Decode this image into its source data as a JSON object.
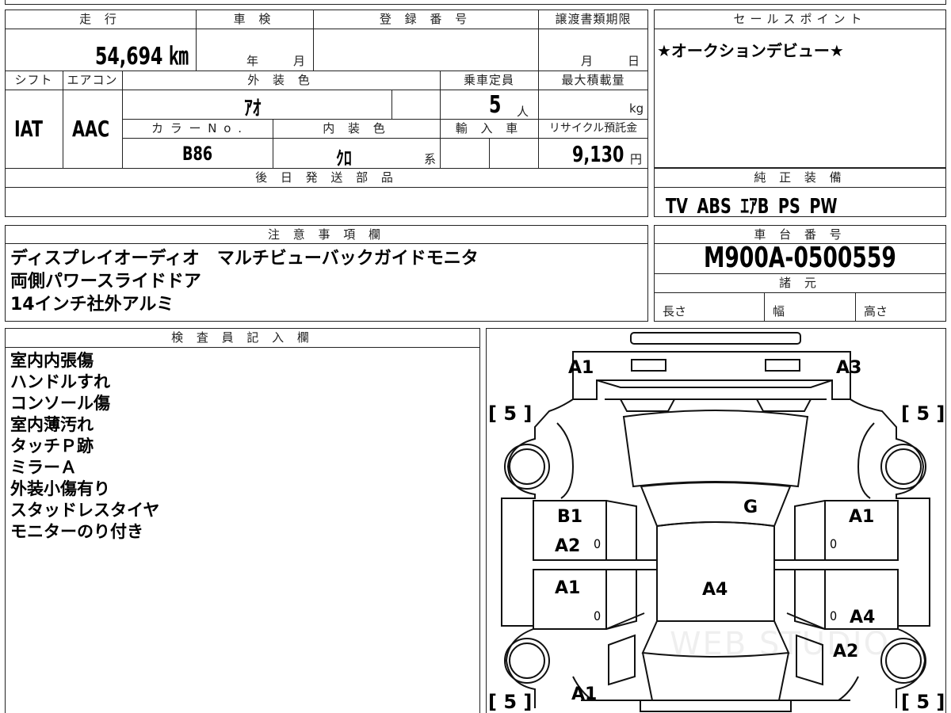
{
  "vehicle": {
    "mileage_label": "走 行",
    "mileage": "54,694 ㎞",
    "inspection_label": "車 検",
    "inspection_year_unit": "年",
    "inspection_month_unit": "月",
    "registration_label": "登 録 番 号",
    "transfer_deadline_label": "譲渡書類期限",
    "transfer_month_unit": "月",
    "transfer_day_unit": "日",
    "shift_label": "シフト",
    "shift": "IAT",
    "aircon_label": "エアコン",
    "aircon": "AAC",
    "exterior_color_label": "外 装 色",
    "exterior_color": "ｱｵ",
    "capacity_label": "乗車定員",
    "capacity": "5",
    "capacity_unit": "人",
    "max_load_label": "最大積載量",
    "max_load_unit": "kg",
    "color_no_label": "カ ラ ー N o .",
    "color_no": "B86",
    "interior_color_label": "内 装 色",
    "interior_color": "ｸﾛ",
    "interior_color_suffix": "系",
    "import_label": "輸 入 車",
    "recycle_label": "リサイクル預託金",
    "recycle_fee": "9,130",
    "recycle_unit": "円",
    "later_parts_label": "後 日 発 送 部 品"
  },
  "sales_point": {
    "label": "セールスポイント",
    "text": "★オークションデビュー★"
  },
  "standard_equipment": {
    "label": "純 正 装 備",
    "text": "TV ABS ｴｱB PS PW"
  },
  "notes": {
    "label": "注 意 事 項 欄",
    "lines": [
      "ディスプレイオーディオ　マルチビューバックガイドモニタ",
      "両側パワースライドドア",
      "14インチ社外アルミ"
    ]
  },
  "chassis": {
    "label": "車 台 番 号",
    "number": "M900A-0500559",
    "spec_label": "諸 元",
    "length_label": "長さ",
    "width_label": "幅",
    "height_label": "高さ"
  },
  "inspector": {
    "label": "検 査 員 記 入 欄",
    "lines": [
      "室内内張傷",
      "ハンドルすれ",
      "コンソール傷",
      "室内薄汚れ",
      "タッチＰ跡",
      "ミラーＡ",
      "外装小傷有り",
      "スタッドレスタイヤ",
      "モニターのり付き"
    ]
  },
  "diagram": {
    "front_left": "A1",
    "front_right": "A3",
    "windshield": "G",
    "left_front_door_1": "B1",
    "left_front_door_2": "A2",
    "left_front_zero": "0",
    "left_rear_door": "A1",
    "left_rear_zero": "0",
    "right_front_door": "A1",
    "right_front_zero": "0",
    "right_rear_zero": "0",
    "right_rear_door": "A4",
    "roof": "A4",
    "right_quarter": "A2",
    "rear_left": "A1",
    "tire_fl": "[ 5 ]",
    "tire_fr": "[ 5 ]",
    "tire_rl": "[ 5 ]",
    "tire_rr": "[ 5 ]"
  },
  "watermark": "WEB STUDIO"
}
